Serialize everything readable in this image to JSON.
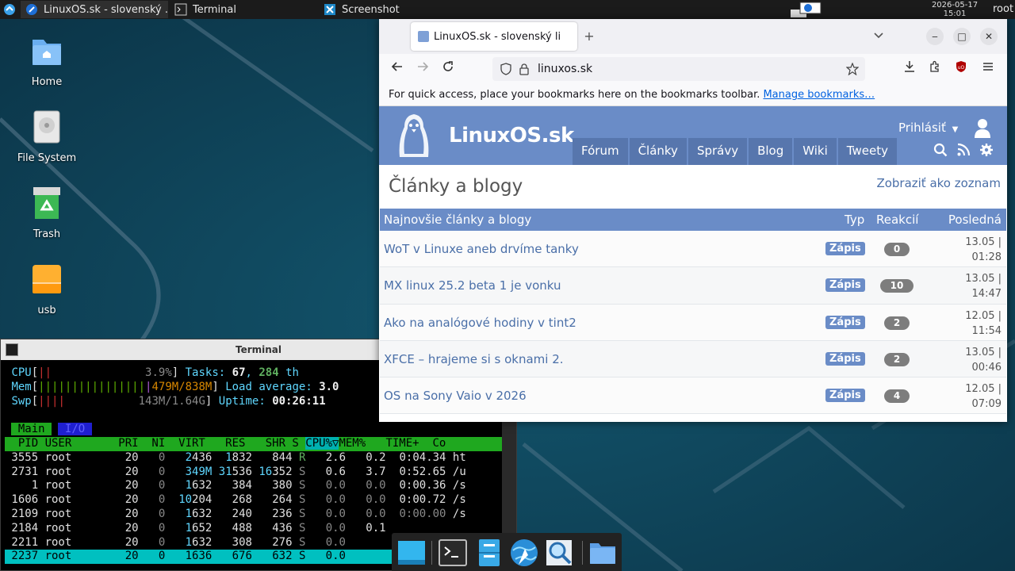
{
  "colors": {
    "site_blue": "#6a8cc7",
    "site_nav": "#5776ad",
    "link_blue": "#4a6fa8",
    "panel_bg": "#1b1b1b",
    "desktop_bg": "#0f3d52"
  },
  "top_panel": {
    "tasks": [
      {
        "label": "LinuxOS.sk - slovenský ...",
        "icon": "browser-icon"
      },
      {
        "label": "Terminal",
        "icon": "terminal-icon"
      },
      {
        "label": "Screenshot",
        "icon": "screenshot-icon"
      }
    ],
    "clock_date": "2026-05-17",
    "clock_time": "15:01",
    "user": "root"
  },
  "desktop_icons": [
    {
      "label": "Home",
      "icon": "home-folder-icon"
    },
    {
      "label": "File System",
      "icon": "drive-icon"
    },
    {
      "label": "Trash",
      "icon": "trash-icon"
    },
    {
      "label": "usb",
      "icon": "usb-drive-icon"
    }
  ],
  "terminal": {
    "title": "Terminal",
    "cpu_label": "CPU",
    "cpu_bars": "||",
    "cpu_value": "3.9%",
    "mem_label": "Mem",
    "mem_bars": "||||||||||||||||",
    "mem_value": "479M/838M",
    "swp_label": "Swp",
    "swp_bars": "||||",
    "swp_value": "143M/1.64G",
    "tasks_label": "Tasks: ",
    "tasks_value": "67",
    "tasks_sep": ", ",
    "threads_value": "284",
    "threads_label": " th",
    "load_label": "Load average: ",
    "load_value": "3.0",
    "uptime_label": "Uptime: ",
    "uptime_value": "00:26:11",
    "tab_main": "Main",
    "tab_io": "I/O",
    "header_pre": "  PID USER       PRI  NI  VIRT   RES   SHR S ",
    "header_sort": "CPU%▽",
    "header_post": "MEM%   TIME+  Co",
    "rows": [
      {
        "pid": " 3555",
        "user": "root",
        "pri": "20",
        "ni": "0",
        "virt_a": "2",
        "virt_b": "436",
        "res_a": "1",
        "res_b": "832",
        "shr_a": "",
        "shr_b": "844",
        "s": "R",
        "cpu": "2.6",
        "mem": "0.2",
        "time": "0:04.34",
        "cmd": "ht"
      },
      {
        "pid": " 2731",
        "user": "root",
        "pri": "20",
        "ni": "0",
        "virt_a": "349M",
        "virt_b": "",
        "res_a": "31",
        "res_b": "536",
        "shr_a": "16",
        "shr_b": "352",
        "s": "S",
        "cpu": "0.6",
        "mem": "3.7",
        "time": "0:52.65",
        "cmd": "/u"
      },
      {
        "pid": "    1",
        "user": "root",
        "pri": "20",
        "ni": "0",
        "virt_a": "1",
        "virt_b": "632",
        "res_a": "",
        "res_b": "384",
        "shr_a": "",
        "shr_b": "380",
        "s": "S",
        "cpu": "0.0",
        "mem": "0.0",
        "time": "0:00.36",
        "cmd": "/s"
      },
      {
        "pid": " 1606",
        "user": "root",
        "pri": "20",
        "ni": "0",
        "virt_a": "10",
        "virt_b": "204",
        "res_a": "",
        "res_b": "268",
        "shr_a": "",
        "shr_b": "264",
        "s": "S",
        "cpu": "0.0",
        "mem": "0.0",
        "time": "0:00.72",
        "cmd": "/s"
      },
      {
        "pid": " 2109",
        "user": "root",
        "pri": "20",
        "ni": "0",
        "virt_a": "1",
        "virt_b": "632",
        "res_a": "",
        "res_b": "240",
        "shr_a": "",
        "shr_b": "236",
        "s": "S",
        "cpu": "0.0",
        "mem": "0.0",
        "time": "0:00.00",
        "cmd": "/s"
      },
      {
        "pid": " 2184",
        "user": "root",
        "pri": "20",
        "ni": "0",
        "virt_a": "1",
        "virt_b": "652",
        "res_a": "",
        "res_b": "488",
        "shr_a": "",
        "shr_b": "436",
        "s": "S",
        "cpu": "0.0",
        "mem": "0.1",
        "time": "",
        "cmd": ""
      },
      {
        "pid": " 2211",
        "user": "root",
        "pri": "20",
        "ni": "0",
        "virt_a": "1",
        "virt_b": "632",
        "res_a": "",
        "res_b": "308",
        "shr_a": "",
        "shr_b": "276",
        "s": "S",
        "cpu": "0.0",
        "mem": "",
        "time": "",
        "cmd": ""
      },
      {
        "pid": " 2237",
        "user": "root",
        "pri": "20",
        "ni": "0",
        "virt_a": "1636",
        "virt_b": "",
        "res_a": "",
        "res_b": "676",
        "shr_a": "",
        "shr_b": "632",
        "s": "S",
        "cpu": "0.0",
        "mem": "",
        "time": "",
        "cmd": ""
      }
    ]
  },
  "browser": {
    "tab_title": "LinuxOS.sk - slovenský li",
    "url": "linuxos.sk",
    "bookmarks_hint": "For quick access, place your bookmarks here on the bookmarks toolbar.",
    "manage_bookmarks": "Manage bookmarks…"
  },
  "site": {
    "logo_text": "LinuxOS.sk",
    "login": "Prihlásiť",
    "nav": [
      "Fórum",
      "Články",
      "Správy",
      "Blog",
      "Wiki",
      "Tweety"
    ],
    "heading": "Články a blogy",
    "view_toggle": "Zobraziť ako zoznam",
    "table_headers": {
      "title": "Najnovšie články a blogy",
      "type": "Typ",
      "reactions": "Reakcií",
      "last": "Posledná"
    },
    "articles": [
      {
        "title": "WoT v Linuxe aneb drvíme tanky",
        "type": "Zápis",
        "reactions": "0",
        "date": "13.05 |",
        "time": "01:28"
      },
      {
        "title": "MX linux 25.2 beta 1 je vonku",
        "type": "Zápis",
        "reactions": "10",
        "date": "13.05 |",
        "time": "14:47"
      },
      {
        "title": "Ako na analógové hodiny v tint2",
        "type": "Zápis",
        "reactions": "2",
        "date": "12.05 |",
        "time": "11:54"
      },
      {
        "title": "XFCE – hrajeme si s oknami 2.",
        "type": "Zápis",
        "reactions": "2",
        "date": "13.05 |",
        "time": "00:46"
      },
      {
        "title": "OS na Sony Vaio v 2026",
        "type": "Zápis",
        "reactions": "4",
        "date": "12.05 |",
        "time": "07:09"
      }
    ]
  },
  "dock": {
    "items": [
      "show-desktop-icon",
      "terminal-icon",
      "file-manager-icon",
      "web-browser-icon",
      "search-app-icon",
      "folder-icon"
    ]
  }
}
